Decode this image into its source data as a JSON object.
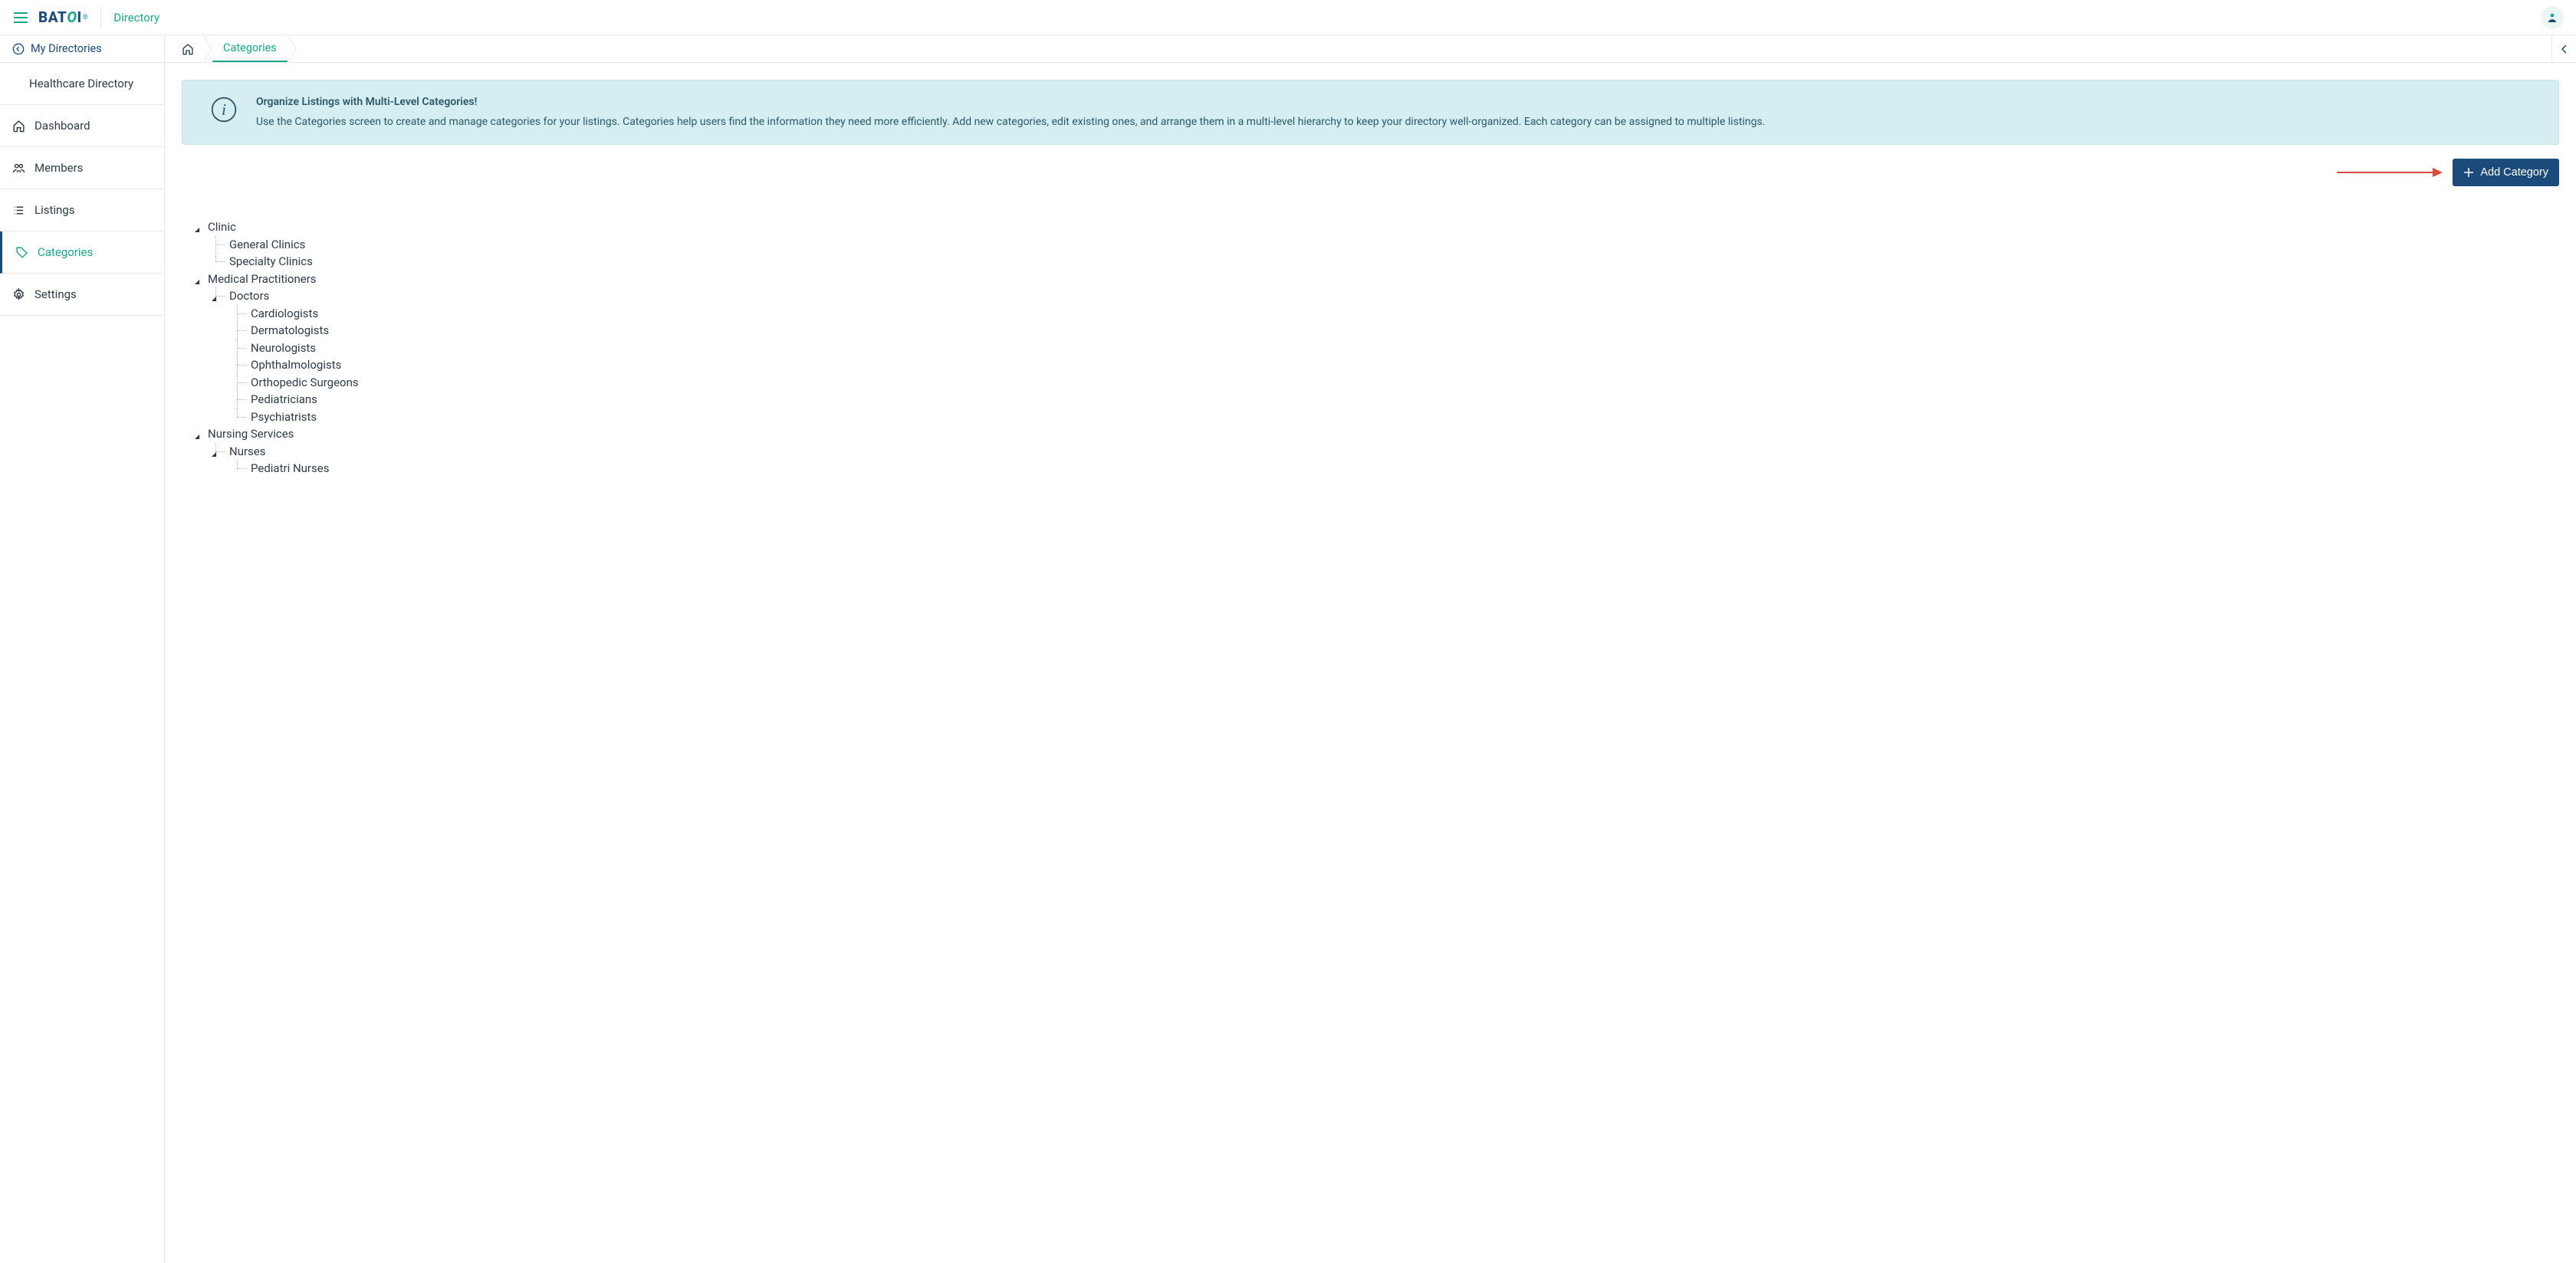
{
  "header": {
    "app_name": "Directory",
    "logo_text_1": "BAT",
    "logo_text_2": "O",
    "logo_text_3": "I",
    "logo_reg": "®"
  },
  "sidebar": {
    "back_label": "My Directories",
    "title": "Healthcare Directory",
    "nav": [
      {
        "icon": "home",
        "label": "Dashboard"
      },
      {
        "icon": "members",
        "label": "Members"
      },
      {
        "icon": "listings",
        "label": "Listings"
      },
      {
        "icon": "tags",
        "label": "Categories",
        "sub": true,
        "active": true
      },
      {
        "icon": "gear",
        "label": "Settings"
      }
    ]
  },
  "breadcrumb": {
    "items": [
      {
        "label": "Categories",
        "active": true
      }
    ]
  },
  "banner": {
    "title": "Organize Listings with Multi-Level Categories!",
    "body": "Use the Categories screen to create and manage categories for your listings. Categories help users find the information they need more efficiently. Add new categories, edit existing ones, and arrange them in a multi-level hierarchy to keep your directory well-organized. Each category can be assigned to multiple listings."
  },
  "actions": {
    "add_category": "Add Category"
  },
  "tree": [
    {
      "label": "Clinic",
      "children": [
        {
          "label": "General Clinics"
        },
        {
          "label": "Specialty Clinics"
        }
      ]
    },
    {
      "label": "Medical Practitioners",
      "children": [
        {
          "label": "Doctors",
          "children": [
            {
              "label": "Cardiologists"
            },
            {
              "label": "Dermatologists"
            },
            {
              "label": "Neurologists"
            },
            {
              "label": "Ophthalmologists"
            },
            {
              "label": "Orthopedic Surgeons"
            },
            {
              "label": "Pediatricians"
            },
            {
              "label": "Psychiatrists"
            }
          ]
        }
      ]
    },
    {
      "label": "Nursing Services",
      "children": [
        {
          "label": "Nurses",
          "children": [
            {
              "label": "Pediatri Nurses"
            }
          ]
        }
      ]
    }
  ]
}
